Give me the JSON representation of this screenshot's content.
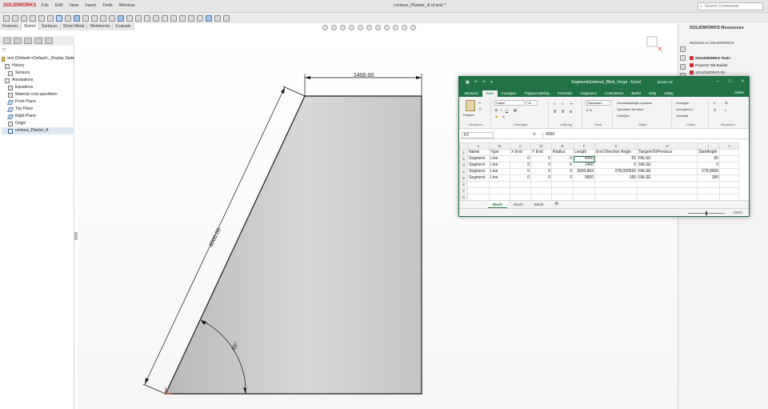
{
  "app": {
    "logo": "SOLIDWORKS",
    "menu": [
      "File",
      "Edit",
      "View",
      "Insert",
      "Tools",
      "Window"
    ],
    "document_title": "contour_Planter_A of test *",
    "search_placeholder": "Search Commands"
  },
  "command_tabs": [
    "Features",
    "Sketch",
    "Surfaces",
    "Sheet Metal",
    "Weldments",
    "Evaluate"
  ],
  "active_command_tab": "Sketch",
  "feature_tree": {
    "items": [
      {
        "label": "test  (Default<<Default>_Display State",
        "icon": "part"
      },
      {
        "label": "History",
        "icon": "history"
      },
      {
        "label": "Sensors",
        "icon": "sensor"
      },
      {
        "label": "Annotations",
        "icon": "annotation"
      },
      {
        "label": "Equations",
        "icon": "equation"
      },
      {
        "label": "Material <not specified>",
        "icon": "material"
      },
      {
        "label": "Front Plane",
        "icon": "plane"
      },
      {
        "label": "Top Plane",
        "icon": "plane"
      },
      {
        "label": "Right Plane",
        "icon": "plane"
      },
      {
        "label": "Origin",
        "icon": "origin"
      },
      {
        "label": "contour_Planter_A",
        "icon": "sketch"
      }
    ]
  },
  "sketch": {
    "dim_top": "1400.00",
    "dim_slant": "4000.00",
    "dim_angle": "65°",
    "fill_color": "#c8c8c8",
    "line_color": "#1a1a1a"
  },
  "task_pane": {
    "header": "SOLIDWORKS Resources",
    "welcome": "Welcome to SOLIDWORKS",
    "items": [
      {
        "label": "SOLIDWORKS Tools",
        "head": true
      },
      {
        "label": "Property Tab Builder",
        "head": false
      },
      {
        "label": "SOLIDWORKS Rx",
        "head": false
      }
    ]
  },
  "excel": {
    "title": "SegmentsExternal_Blink_Vorge - Excel",
    "user": "jeroen vd",
    "tabs": [
      "Bestand",
      "Start",
      "Invoegen",
      "Pagina-indeling",
      "Formules",
      "Gegevens",
      "Controleren",
      "Beeld",
      "Help",
      "Uitleg"
    ],
    "active_tab": "Start",
    "share": "Delen",
    "ribbon": {
      "clipboard_label": "Klembord",
      "paste": "Plakken",
      "font_name": "Calibri",
      "font_size": "11",
      "font_label": "Lettertype",
      "align_label": "Uitlijning",
      "number_format": "Standaard",
      "number_label": "Getal",
      "styles": [
        "Voorwaardelijke opmaak",
        "Opmaken als tabel",
        "Celstijlen"
      ],
      "styles_label": "Stijlen",
      "cells": [
        "Invoegen",
        "Verwijderen",
        "Opmaak"
      ],
      "cells_label": "Cellen",
      "edit_label": "Bewerken"
    },
    "name_box": "F2",
    "formula_value": "4000",
    "columns": [
      "A",
      "B",
      "C",
      "D",
      "E",
      "F",
      "G",
      "H",
      "I",
      "J"
    ],
    "rows": [
      [
        "Name",
        "Type",
        "X End",
        "Y End",
        "Radius",
        "Length",
        "End Direction Angle",
        "TangentToPrevious",
        "StartAngle",
        ""
      ],
      [
        "Segment",
        "Line",
        "0",
        "0",
        "0",
        "4000",
        "65",
        "FALSE",
        "65",
        ""
      ],
      [
        "Segment",
        "Line",
        "0",
        "0",
        "0",
        "1400",
        "0",
        "FALSE",
        "0",
        ""
      ],
      [
        "Segment",
        "Line",
        "0",
        "0",
        "0",
        "3660,863",
        "278,000526",
        "FALSE",
        "278,0005",
        ""
      ],
      [
        "Segment",
        "Line",
        "0",
        "0",
        "0",
        "3600",
        "180",
        "FALSE",
        "180",
        ""
      ],
      [
        "",
        "",
        "",
        "",
        "",
        "",
        "",
        "",
        "",
        ""
      ],
      [
        "",
        "",
        "",
        "",
        "",
        "",
        "",
        "",
        "",
        ""
      ],
      [
        "",
        "",
        "",
        "",
        "",
        "",
        "",
        "",
        "",
        ""
      ]
    ],
    "sheets": [
      "Blad1",
      "Blad2",
      "Blad3"
    ],
    "active_sheet": "Blad1",
    "zoom": "100%",
    "colors": {
      "accent": "#217346"
    }
  }
}
